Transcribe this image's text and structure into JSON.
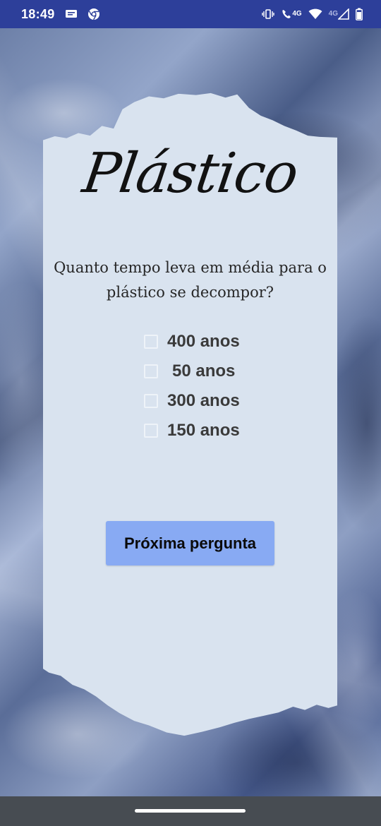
{
  "status_bar": {
    "time": "18:49",
    "net_primary": "4G",
    "net_secondary": "4G",
    "icons": [
      "message-icon",
      "chrome-icon",
      "vibrate-icon",
      "wifi-call-icon",
      "wifi-icon",
      "signal-icon",
      "battery-icon"
    ]
  },
  "quiz": {
    "title": "Plástico",
    "question_line1": "Quanto tempo leva em média para o",
    "question_line2": "plástico se decompor?",
    "options": [
      {
        "label": "400 anos",
        "checked": false
      },
      {
        "label": "50 anos",
        "checked": false
      },
      {
        "label": "300 anos",
        "checked": false
      },
      {
        "label": "150 anos",
        "checked": false
      }
    ],
    "next_button_label": "Próxima pergunta"
  },
  "colors": {
    "status_bar": "#2d3f9a",
    "paper": "#d9e3ef",
    "button": "#88aaf3",
    "nav_bar": "#474c52"
  }
}
